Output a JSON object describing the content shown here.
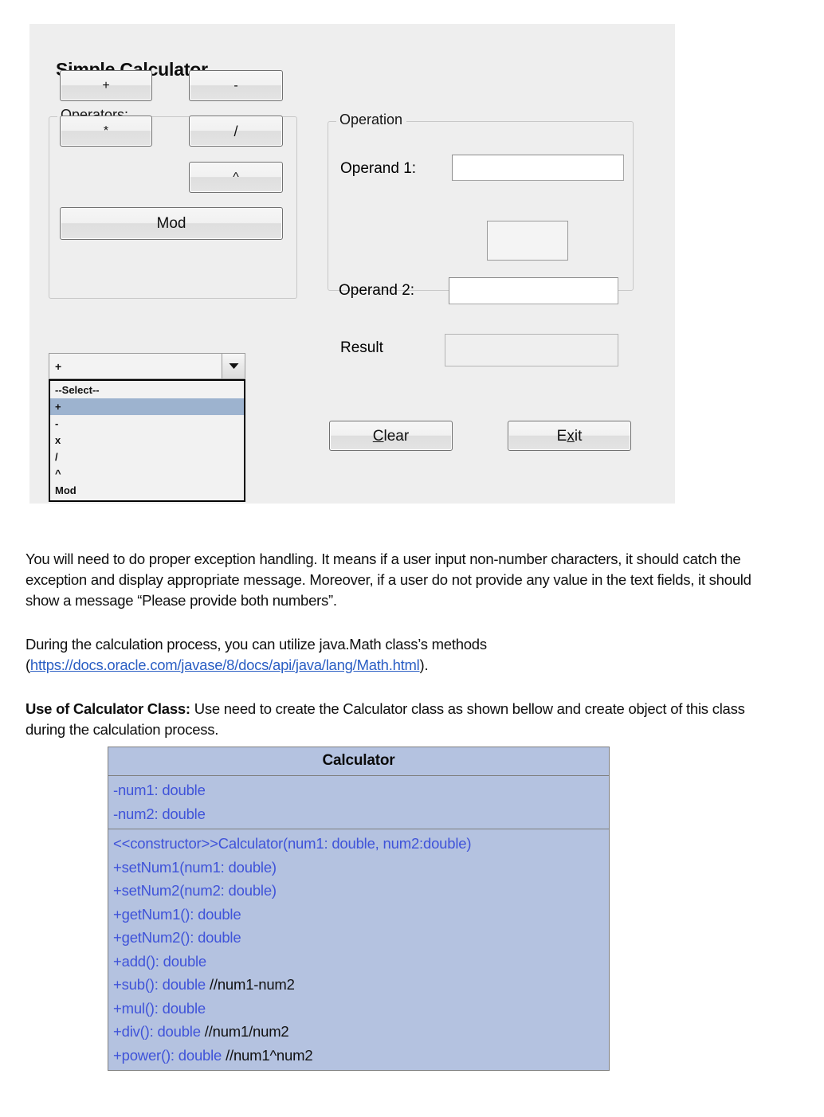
{
  "app": {
    "title": "Simple Calculator",
    "operators_group_label": "Operators:",
    "operation_group_label": "Operation",
    "buttons": {
      "add": "+",
      "sub": "-",
      "mul": "*",
      "div": "/",
      "pow": "^",
      "mod": "Mod",
      "clear_prefix": "",
      "clear_accel": "C",
      "clear_rest": "lear",
      "clear_full": "Clear",
      "exit_prefix": "E",
      "exit_accel": "x",
      "exit_rest": "it",
      "exit_full": "Exit"
    },
    "fields": {
      "operand1_label": "Operand 1:",
      "operand1_value": "",
      "middle_box_value": "",
      "operand2_label": "Operand 2:",
      "operand2_value": "",
      "result_label": "Result",
      "result_value": ""
    },
    "combo": {
      "selected": "+",
      "arrow_icon": "chevron-down-icon",
      "options": [
        "--Select--",
        "+",
        "-",
        "x",
        "/",
        "^",
        "Mod"
      ],
      "highlighted_index": 1
    }
  },
  "document": {
    "para1": "You will need to do proper exception handling. It means if a user input non-number characters, it should catch the exception and display appropriate message. Moreover, if a user do not provide any value in the text fields, it should show a message “Please provide both numbers”.",
    "para2_before": "During the calculation process, you can utilize java.Math class’s methods (",
    "para2_link": "https://docs.oracle.com/javase/8/docs/api/java/lang/Math.html",
    "para2_after": ").",
    "para3_bold": "Use of Calculator Class:",
    "para3_rest": " Use need to create the Calculator class as shown bellow and create object of this class during the calculation process."
  },
  "uml": {
    "class_name": "Calculator",
    "attributes": [
      "-num1: double",
      "-num2: double"
    ],
    "methods": [
      {
        "sig": "<<constructor>>Calculator(num1: double, num2:double)",
        "comment": ""
      },
      {
        "sig": "+setNum1(num1: double)",
        "comment": ""
      },
      {
        "sig": "+setNum2(num2: double)",
        "comment": ""
      },
      {
        "sig": "+getNum1(): double",
        "comment": ""
      },
      {
        "sig": "+getNum2(): double",
        "comment": ""
      },
      {
        "sig": "+add(): double",
        "comment": ""
      },
      {
        "sig": "+sub(): double ",
        "comment": " //num1-num2"
      },
      {
        "sig": "+mul(): double",
        "comment": ""
      },
      {
        "sig": "+div(): double ",
        "comment": "//num1/num2"
      },
      {
        "sig": "+power(): double ",
        "comment": "//num1^num2"
      }
    ]
  },
  "colors": {
    "uml_fill": "#b4c2e0",
    "uml_text": "#3f53d9",
    "link": "#2b5fc4",
    "screenshot_bg": "#eeeeee",
    "combo_highlight": "#9db3cf"
  }
}
